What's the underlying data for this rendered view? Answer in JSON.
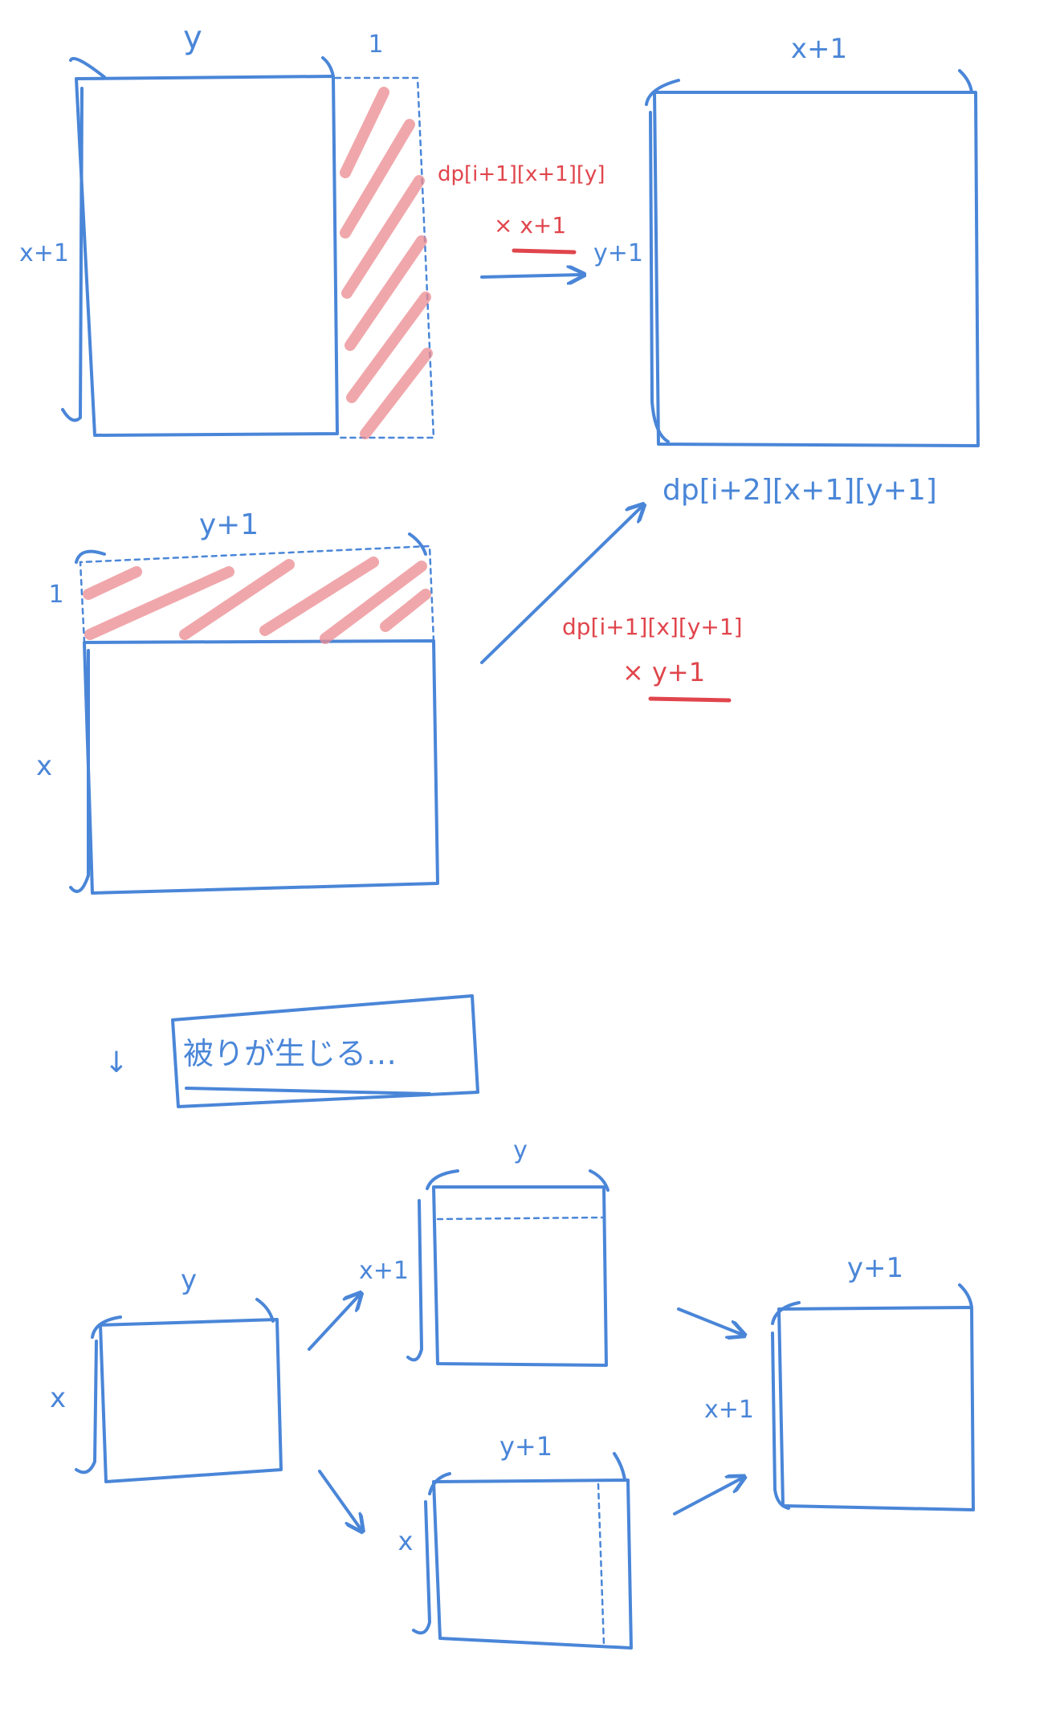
{
  "colors": {
    "pen_blue": "#4a86d8",
    "pen_red": "#e0454c",
    "hatch_red": "#ec8a90",
    "background": "#ffffff"
  },
  "top_left_rect": {
    "top_label": "y",
    "side_label": "x+1",
    "strip_label": "1"
  },
  "top_right_rect": {
    "top_label": "x+1",
    "side_label": "y+1",
    "bottom_formula": "dp[i+2][x+1][y+1]"
  },
  "transition_1": {
    "formula": "dp[i+1][x+1][y]",
    "multiplier": "× x+1"
  },
  "mid_rect": {
    "top_label": "y+1",
    "side_label": "x",
    "strip_label": "1"
  },
  "transition_2": {
    "formula": "dp[i+1][x][y+1]",
    "multiplier": "× y+1"
  },
  "note": {
    "arrow": "↓",
    "text": "被りが生じる…"
  },
  "bottom": {
    "start": {
      "top_label": "y",
      "side_label": "x"
    },
    "upper": {
      "top_label": "y",
      "side_label": "x+1"
    },
    "lower": {
      "top_label": "y+1",
      "side_label": "x"
    },
    "final": {
      "top_label": "y+1",
      "side_label": "x+1"
    }
  }
}
